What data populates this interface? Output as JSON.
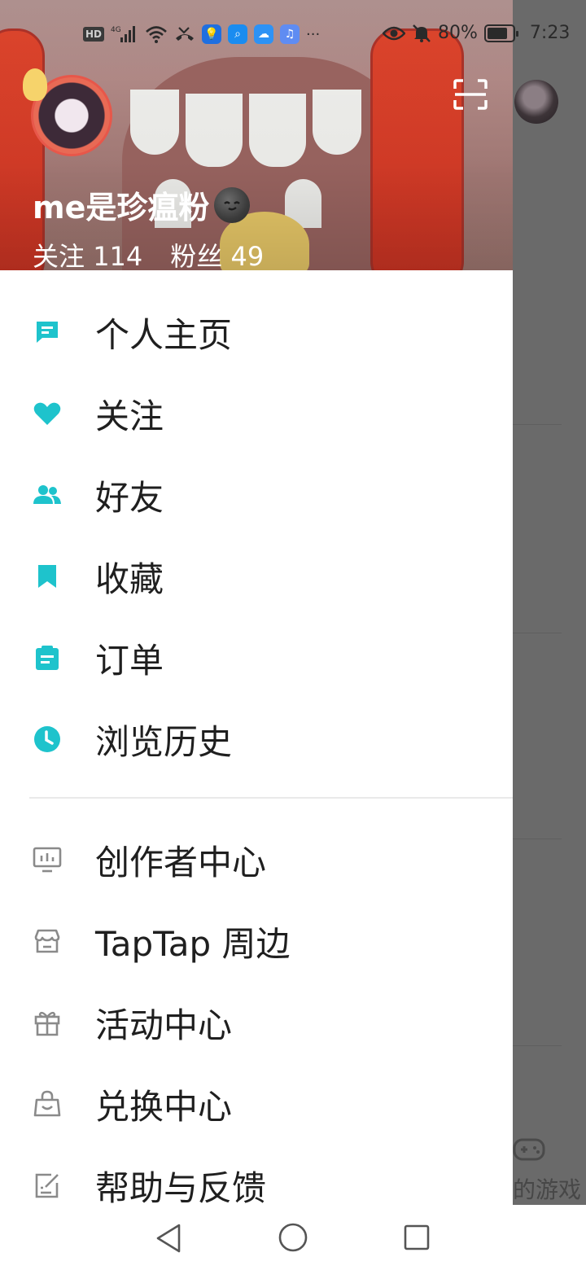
{
  "status_bar": {
    "network_badge": "HD",
    "network_type": "4G",
    "eye_icon": "eye-icon",
    "battery_percent": "80%",
    "battery_level": 0.8,
    "time": "7:23",
    "more": "···"
  },
  "background_app": {
    "bottom_tab_label": "的游戏"
  },
  "profile": {
    "username": "me是珍瘟粉",
    "following_label": "关注",
    "following_count": "114",
    "followers_label": "粉丝",
    "followers_count": "49"
  },
  "menu_primary": [
    {
      "label": "个人主页",
      "icon": "profile-page-icon"
    },
    {
      "label": "关注",
      "icon": "heart-icon"
    },
    {
      "label": "好友",
      "icon": "friends-icon"
    },
    {
      "label": "收藏",
      "icon": "bookmark-icon"
    },
    {
      "label": "订单",
      "icon": "order-icon"
    },
    {
      "label": "浏览历史",
      "icon": "clock-icon"
    }
  ],
  "menu_secondary": [
    {
      "label": "创作者中心",
      "icon": "creator-chart-icon"
    },
    {
      "label": "TapTap 周边",
      "icon": "store-icon"
    },
    {
      "label": "活动中心",
      "icon": "gift-icon"
    },
    {
      "label": "兑换中心",
      "icon": "shopping-bag-icon"
    },
    {
      "label": "帮助与反馈",
      "icon": "edit-feedback-icon"
    }
  ],
  "colors": {
    "accent": "#1ec3cc",
    "secondary_icon": "#8a8a8a",
    "text": "#1f1f1f"
  }
}
